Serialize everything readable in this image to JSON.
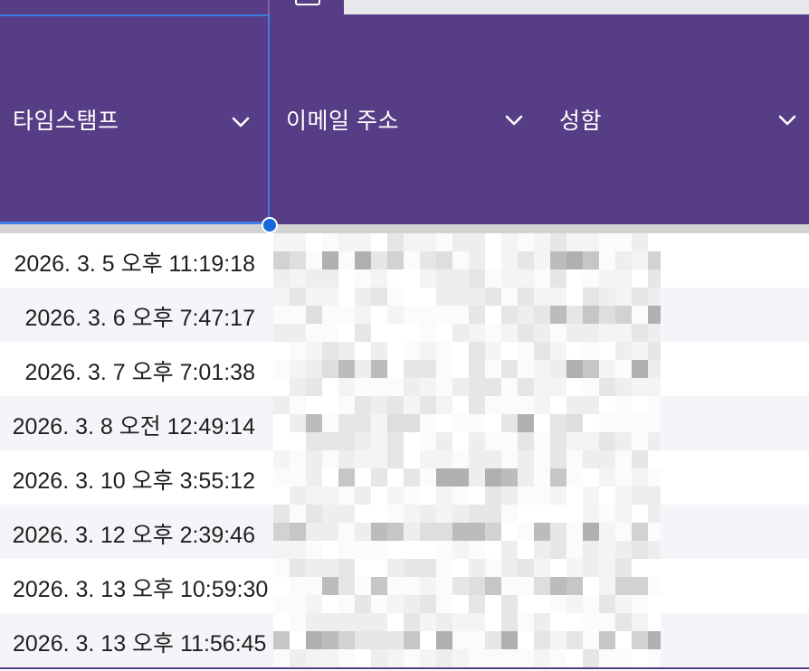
{
  "columns": {
    "timestamp": {
      "label": "타임스탬프"
    },
    "email": {
      "label": "이메일 주소"
    },
    "name": {
      "label": "성함"
    }
  },
  "rows": [
    {
      "timestamp": "2026. 3. 5 오후 11:19:18"
    },
    {
      "timestamp": "2026. 3. 6 오후 7:47:17"
    },
    {
      "timestamp": "2026. 3. 7 오후 7:01:38"
    },
    {
      "timestamp": "2026. 3. 8 오전 12:49:14"
    },
    {
      "timestamp": "2026. 3. 10 오후 3:55:12"
    },
    {
      "timestamp": "2026. 3. 12 오후 2:39:46"
    },
    {
      "timestamp": "2026. 3. 13 오후 10:59:30"
    },
    {
      "timestamp": "2026. 3. 13 오후 11:56:45"
    }
  ],
  "colors": {
    "header_bg": "#563d86",
    "selection": "#3c7de6",
    "handle": "#1668dc",
    "row_alt": "#f4f5f8"
  },
  "icons": {
    "sort": "chevron-down-icon",
    "handle": "selection-handle"
  }
}
